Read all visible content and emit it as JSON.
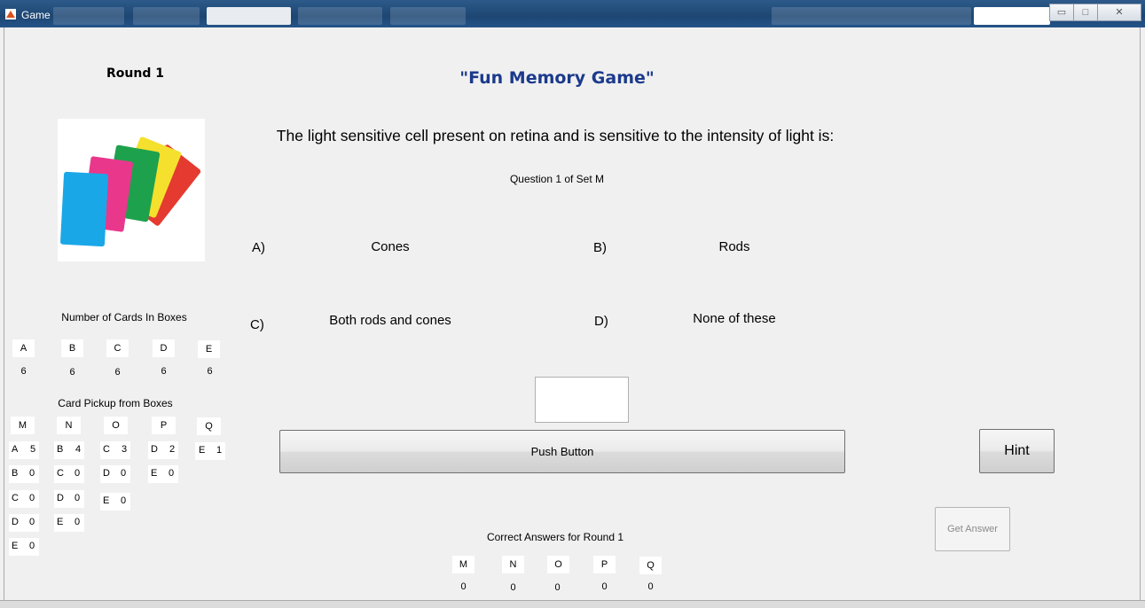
{
  "window": {
    "title": "Game"
  },
  "header": {
    "round_label": "Round 1",
    "game_title": "\"Fun Memory Game\""
  },
  "question": {
    "text": "The light sensitive cell present on retina and is sensitive to the intensity of light is:",
    "subtitle": "Question 1 of Set M"
  },
  "options": [
    {
      "label": "A)",
      "text": "Cones"
    },
    {
      "label": "B)",
      "text": "Rods"
    },
    {
      "label": "C)",
      "text": "Both rods and cones"
    },
    {
      "label": "D)",
      "text": "None of these"
    }
  ],
  "boxes": {
    "title": "Number of Cards In Boxes",
    "items": [
      {
        "name": "A",
        "count": "6"
      },
      {
        "name": "B",
        "count": "6"
      },
      {
        "name": "C",
        "count": "6"
      },
      {
        "name": "D",
        "count": "6"
      },
      {
        "name": "E",
        "count": "6"
      }
    ]
  },
  "pickup": {
    "title": "Card Pickup from Boxes",
    "columns": [
      {
        "name": "M",
        "rows": [
          {
            "box": "A",
            "count": "5"
          },
          {
            "box": "B",
            "count": "0"
          },
          {
            "box": "C",
            "count": "0"
          },
          {
            "box": "D",
            "count": "0"
          },
          {
            "box": "E",
            "count": "0"
          }
        ]
      },
      {
        "name": "N",
        "rows": [
          {
            "box": "B",
            "count": "4"
          },
          {
            "box": "C",
            "count": "0"
          },
          {
            "box": "D",
            "count": "0"
          },
          {
            "box": "E",
            "count": "0"
          }
        ]
      },
      {
        "name": "O",
        "rows": [
          {
            "box": "C",
            "count": "3"
          },
          {
            "box": "D",
            "count": "0"
          },
          {
            "box": "E",
            "count": "0"
          }
        ]
      },
      {
        "name": "P",
        "rows": [
          {
            "box": "D",
            "count": "2"
          },
          {
            "box": "E",
            "count": "0"
          }
        ]
      },
      {
        "name": "Q",
        "rows": [
          {
            "box": "E",
            "count": "1"
          }
        ]
      }
    ]
  },
  "buttons": {
    "push": "Push Button",
    "hint": "Hint",
    "get_answer": "Get Answer"
  },
  "answer_input": {
    "value": ""
  },
  "correct": {
    "title": "Correct Answers for Round 1",
    "items": [
      {
        "name": "M",
        "count": "0"
      },
      {
        "name": "N",
        "count": "0"
      },
      {
        "name": "O",
        "count": "0"
      },
      {
        "name": "P",
        "count": "0"
      },
      {
        "name": "Q",
        "count": "0"
      }
    ]
  }
}
